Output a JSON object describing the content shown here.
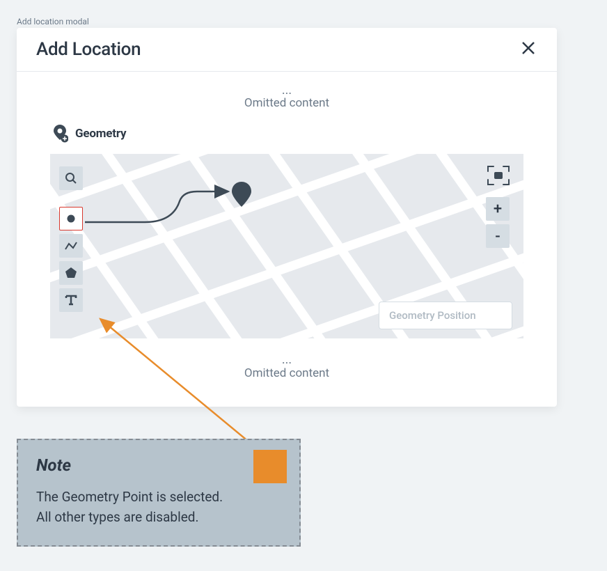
{
  "caption": "Add location modal",
  "modal": {
    "title": "Add Location",
    "omitted_dots": "...",
    "omitted_text": "Omitted content"
  },
  "section": {
    "title": "Geometry"
  },
  "map": {
    "zoom_in": "+",
    "zoom_out": "-",
    "position_placeholder": "Geometry Position"
  },
  "note": {
    "title": "Note",
    "line1": "The Geometry Point is selected.",
    "line2": "All other types are disabled."
  }
}
